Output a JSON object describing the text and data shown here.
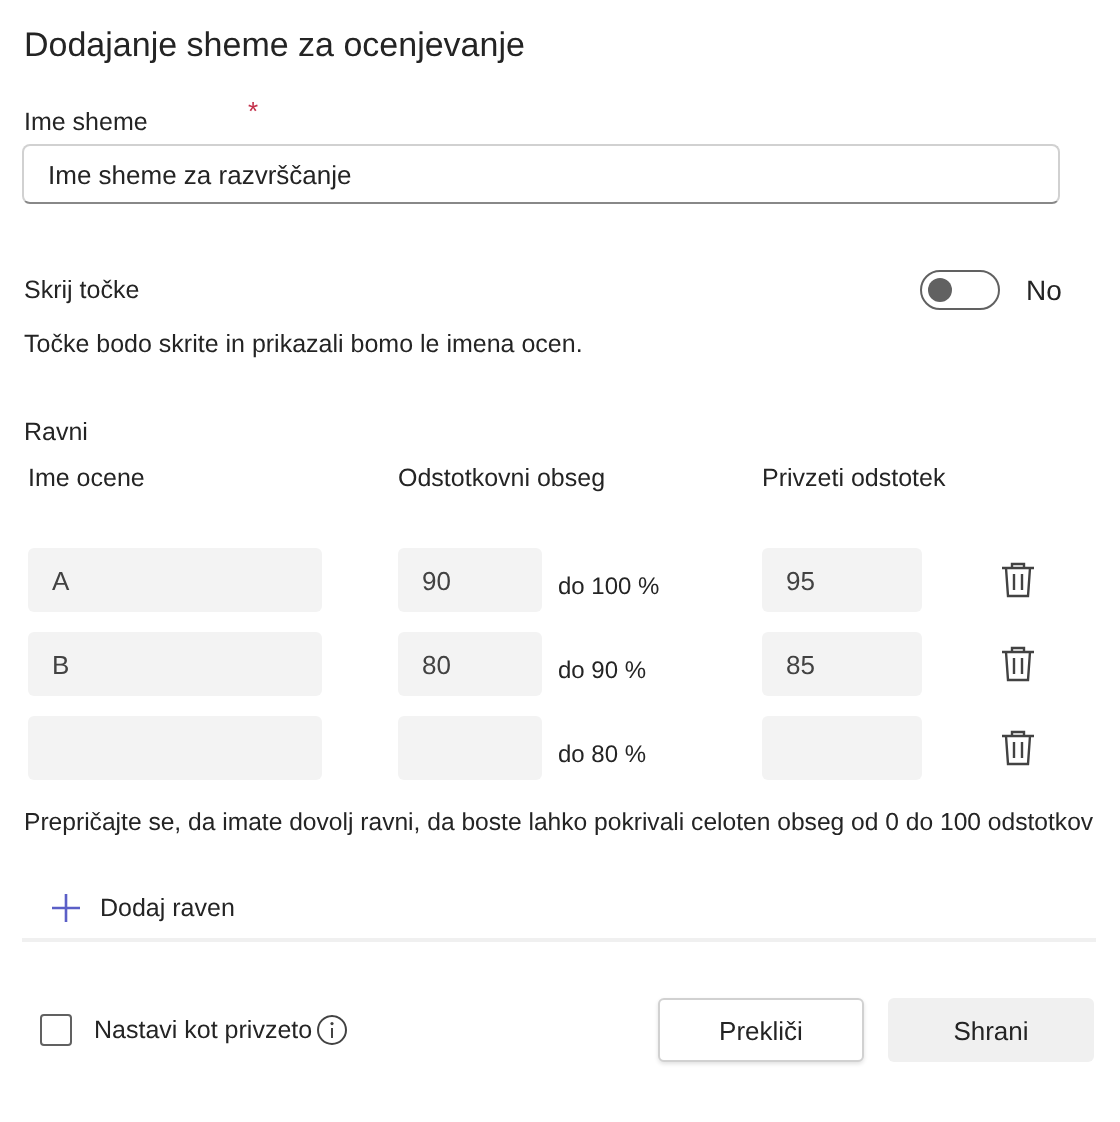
{
  "title": "Dodajanje sheme za ocenjevanje",
  "name_field": {
    "label": "Ime sheme",
    "required_mark": "*",
    "placeholder": "Ime sheme za razvrščanje"
  },
  "hide_points": {
    "label": "Skrij točke",
    "on": false,
    "state_label": "No",
    "description": "Točke bodo skrite in prikazali bomo le imena ocen."
  },
  "levels": {
    "heading": "Ravni",
    "columns": [
      "Ime ocene",
      "Odstotkovni obseg",
      "Privzeti odstotek"
    ],
    "rows": [
      {
        "grade": "A",
        "from": "90",
        "to": "do 100 %",
        "default": "95"
      },
      {
        "grade": "B",
        "from": "80",
        "to": "do 90 %",
        "default": "85"
      },
      {
        "to": "do 80 %"
      }
    ],
    "note": "Prepričajte se, da imate dovolj ravni, da boste lahko pokrivali celoten obseg od 0 do 100 odstotkov",
    "add_label": "Dodaj raven"
  },
  "footer": {
    "default_checkbox": {
      "label": "Nastavi kot privzeto",
      "checked": false
    },
    "buttons": [
      "Prekliči",
      "Shrani"
    ]
  }
}
